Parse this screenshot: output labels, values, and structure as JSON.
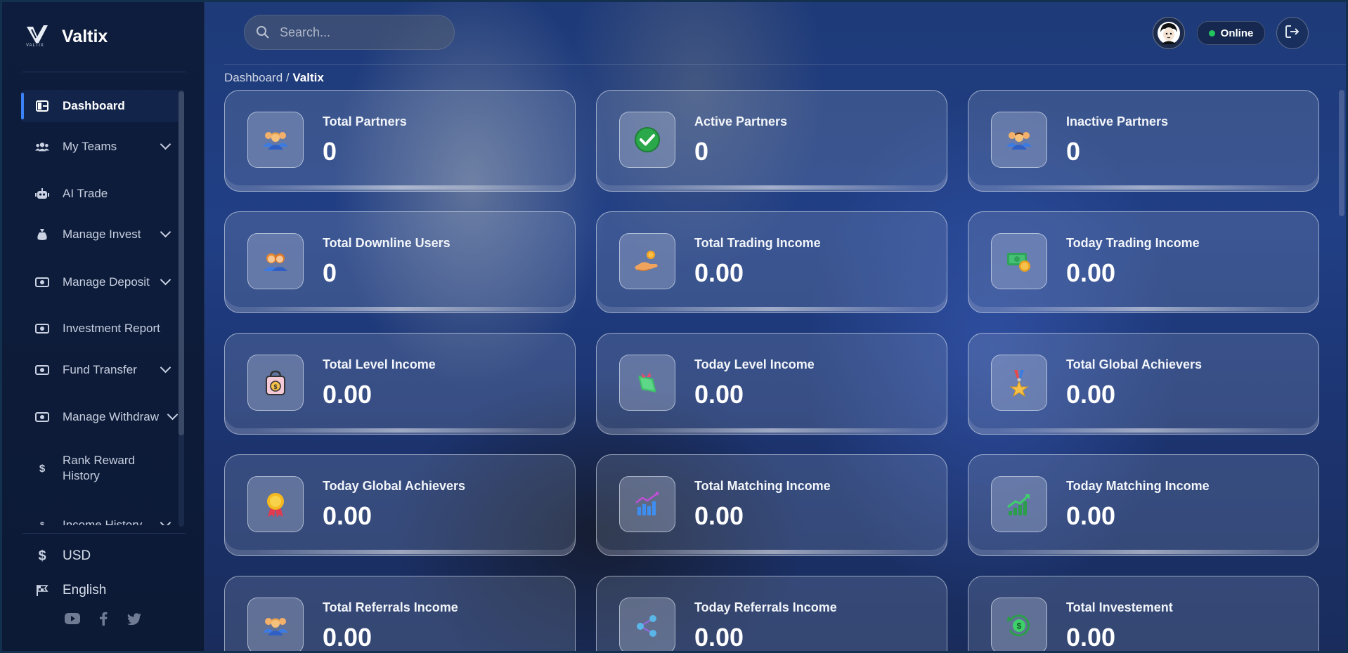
{
  "brand": {
    "name": "Valtix",
    "logo_sub": "VALTIX"
  },
  "search": {
    "placeholder": "Search..."
  },
  "header": {
    "status_label": "Online",
    "status_color": "#22c55e"
  },
  "breadcrumb": {
    "root": "Dashboard",
    "separator": "/",
    "current": "Valtix"
  },
  "sidebar": {
    "items": [
      {
        "label": "Dashboard",
        "icon": "dashboard-icon",
        "active": true
      },
      {
        "label": "My Teams",
        "icon": "users-icon",
        "expandable": true
      },
      {
        "label": "AI Trade",
        "icon": "robot-icon"
      },
      {
        "label": "Manage Invest",
        "icon": "money-bag-icon",
        "expandable": true
      },
      {
        "label": "Manage Deposit",
        "icon": "cash-icon",
        "expandable": true
      },
      {
        "label": "Investment Report",
        "icon": "cash-icon"
      },
      {
        "label": "Fund Transfer",
        "icon": "cash-icon",
        "expandable": true
      },
      {
        "label": "Manage Withdraw",
        "icon": "cash-icon",
        "expandable": true
      },
      {
        "label": "Rank Reward History",
        "icon": "dollar-icon"
      },
      {
        "label": "Income History",
        "icon": "dollar-icon",
        "expandable": true
      }
    ],
    "currency": "USD",
    "language": "English",
    "socials": [
      "youtube-icon",
      "facebook-icon",
      "twitter-icon"
    ]
  },
  "cards": [
    {
      "title": "Total Partners",
      "value": "0",
      "icon": "partners-icon"
    },
    {
      "title": "Active Partners",
      "value": "0",
      "icon": "check-circle-icon"
    },
    {
      "title": "Inactive Partners",
      "value": "0",
      "icon": "partners-icon"
    },
    {
      "title": "Total Downline Users",
      "value": "0",
      "icon": "couple-icon"
    },
    {
      "title": "Total Trading Income",
      "value": "0.00",
      "icon": "hand-coin-icon"
    },
    {
      "title": "Today Trading Income",
      "value": "0.00",
      "icon": "money-coin-icon"
    },
    {
      "title": "Total Level Income",
      "value": "0.00",
      "icon": "shopping-bag-icon"
    },
    {
      "title": "Today Level Income",
      "value": "0.00",
      "icon": "money-bow-icon"
    },
    {
      "title": "Total Global Achievers",
      "value": "0.00",
      "icon": "medal-icon"
    },
    {
      "title": "Today Global Achievers",
      "value": "0.00",
      "icon": "award-badge-icon"
    },
    {
      "title": "Total Matching Income",
      "value": "0.00",
      "icon": "chart-up-icon"
    },
    {
      "title": "Today Matching Income",
      "value": "0.00",
      "icon": "growth-chart-icon"
    },
    {
      "title": "Total Referrals Income",
      "value": "0.00",
      "icon": "partners-icon"
    },
    {
      "title": "Today Referrals Income",
      "value": "0.00",
      "icon": "share-nodes-icon"
    },
    {
      "title": "Total Investement",
      "value": "0.00",
      "icon": "dollar-cycle-icon"
    }
  ]
}
